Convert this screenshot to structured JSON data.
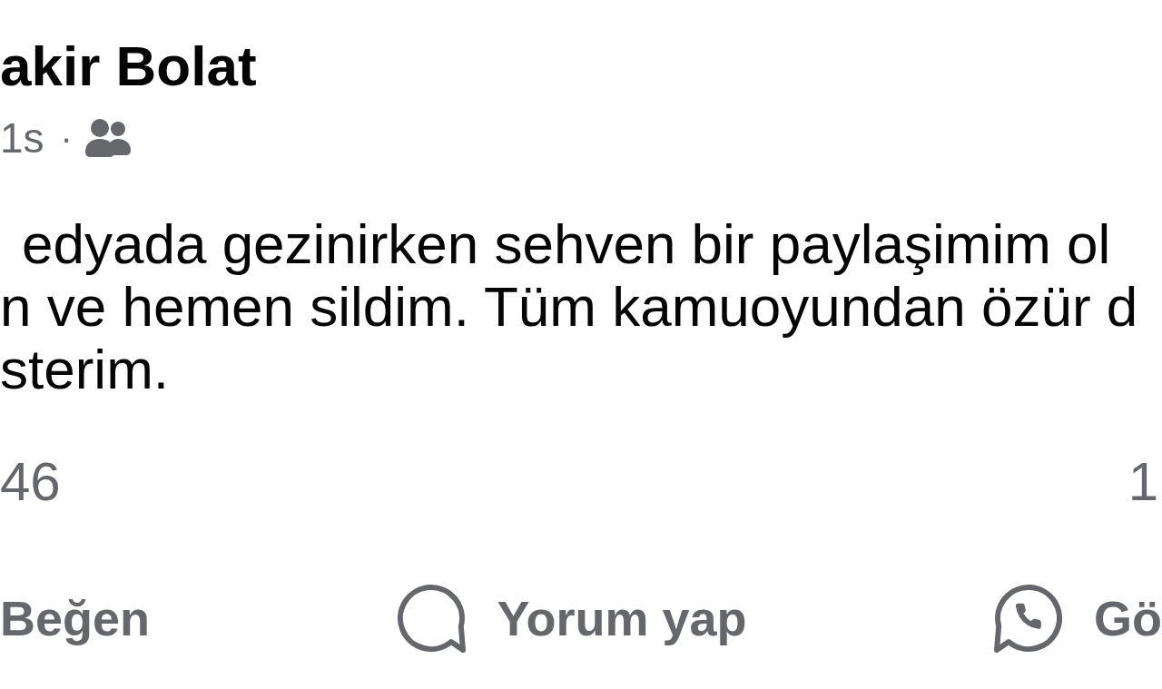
{
  "post": {
    "author": "akir Bolat",
    "time": "1s",
    "separator": "·",
    "text_lines": [
      "edyada gezinirken sehven bir paylaşimim ol",
      "n ve hemen sildim. Tüm kamuoyundan özür d",
      "sterim."
    ],
    "stats": {
      "reactions": "46",
      "comments": "1"
    },
    "actions": [
      {
        "kind": "like",
        "label": "Beğen"
      },
      {
        "kind": "comment",
        "label": "Yorum yap"
      },
      {
        "kind": "share",
        "label": "Gö"
      }
    ]
  }
}
